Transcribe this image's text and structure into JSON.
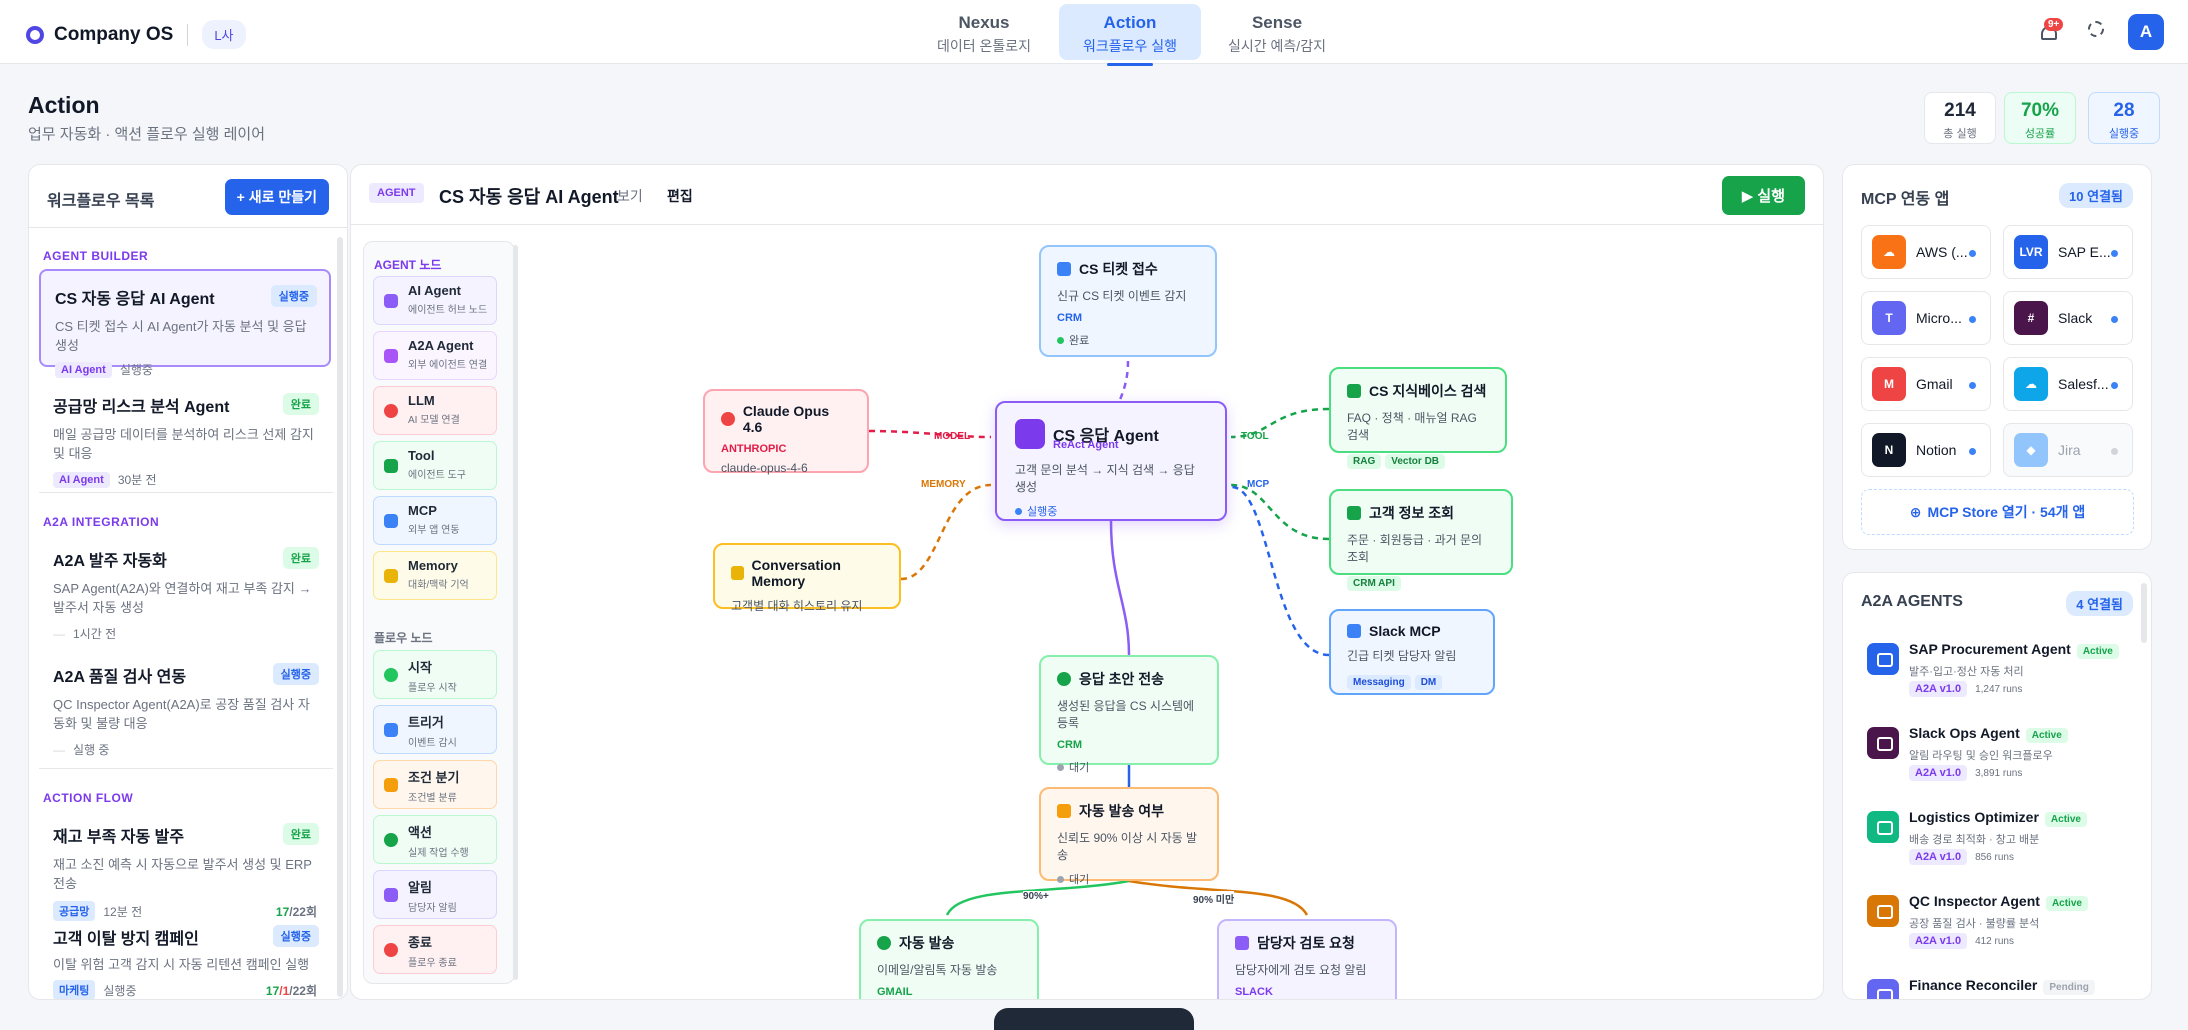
{
  "app": {
    "name": "Company OS",
    "tenant": "L사"
  },
  "nav": [
    {
      "label": "Nexus",
      "sub": "데이터 온톨로지"
    },
    {
      "label": "Action",
      "sub": "워크플로우 실행"
    },
    {
      "label": "Sense",
      "sub": "실시간 예측/감지"
    }
  ],
  "header": {
    "notif_badge": "9+",
    "avatar": "A"
  },
  "page": {
    "title": "Action",
    "subtitle": "업무 자동화 · 액션 플로우 실행 레이어"
  },
  "stats": [
    {
      "value": "214",
      "label": "총 실행"
    },
    {
      "value": "70%",
      "label": "성공률"
    },
    {
      "value": "28",
      "label": "실행중"
    }
  ],
  "workflows": {
    "title": "워크플로우 목록",
    "new_button": "+ 새로 만들기",
    "sections": [
      "AGENT BUILDER",
      "A2A INTEGRATION",
      "ACTION FLOW"
    ],
    "items": [
      {
        "name": "CS 자동 응답 AI Agent",
        "status": "실행중",
        "desc": "CS 티켓 접수 시 AI Agent가 자동 분석 및 응답 생성",
        "tag": "AI Agent",
        "meta": "실행중"
      },
      {
        "name": "공급망 리스크 분석 Agent",
        "status": "완료",
        "desc": "매일 공급망 데이터를 분석하여 리스크 선제 감지 및 대응",
        "tag": "AI Agent",
        "meta": "30분 전"
      },
      {
        "name": "A2A 발주 자동화",
        "status": "완료",
        "desc": "SAP Agent(A2A)와 연결하여 재고 부족 감지 → 발주서 자동 생성",
        "meta": "1시간 전"
      },
      {
        "name": "A2A 품질 검사 연동",
        "status": "실행중",
        "desc": "QC Inspector Agent(A2A)로 공장 품질 검사 자동화 및 불량 대응",
        "meta": "실행 중"
      },
      {
        "name": "재고 부족 자동 발주",
        "status": "완료",
        "desc": "재고 소진 예측 시 자동으로 발주서 생성 및 ERP 전송",
        "tag": "공급망",
        "meta": "12분 전",
        "count_ok": "17",
        "count_total": "/22회"
      },
      {
        "name": "고객 이탈 방지 캠페인",
        "status": "실행중",
        "desc": "이탈 위험 고객 감지 시 자동 리텐션 캠페인 실행",
        "tag": "마케팅",
        "meta": "실행중",
        "count_ok": "17",
        "count_fail": "/1",
        "count_total": "/22회"
      }
    ]
  },
  "canvas": {
    "tag": "AGENT",
    "title": "CS 자동 응답 AI Agent",
    "view_tab": "보기",
    "edit_tab": "편집",
    "run_button": "실행",
    "palette": {
      "agent_header": "AGENT 노드",
      "flow_header": "플로우 노드",
      "agent_nodes": [
        {
          "name": "AI Agent",
          "sub": "에이전트 허브 노드"
        },
        {
          "name": "A2A Agent",
          "sub": "외부 에이전트 연결"
        },
        {
          "name": "LLM",
          "sub": "AI 모델 연결"
        },
        {
          "name": "Tool",
          "sub": "에이전트 도구"
        },
        {
          "name": "MCP",
          "sub": "외부 앱 연동"
        },
        {
          "name": "Memory",
          "sub": "대화/맥락 기억"
        }
      ],
      "flow_nodes": [
        {
          "name": "시작",
          "sub": "플로우 시작"
        },
        {
          "name": "트리거",
          "sub": "이벤트 감시"
        },
        {
          "name": "조건 분기",
          "sub": "조건별 분류"
        },
        {
          "name": "액션",
          "sub": "실제 작업 수행"
        },
        {
          "name": "알림",
          "sub": "담당자 알림"
        },
        {
          "name": "종료",
          "sub": "플로우 종료"
        }
      ]
    },
    "nodes": {
      "ticket": {
        "title": "CS 티켓 접수",
        "desc": "신규 CS 티켓 이벤트 감지",
        "tag": "CRM",
        "status": "완료"
      },
      "agent": {
        "title": "CS 응답 Agent",
        "subtitle": "ReAct Agent",
        "desc": "고객 문의 분석 → 지식 검색 → 응답 생성",
        "status": "실행중"
      },
      "llm": {
        "title": "Claude Opus 4.6",
        "provider": "ANTHROPIC",
        "model": "claude-opus-4-6"
      },
      "memory": {
        "title": "Conversation Memory",
        "desc": "고객별 대화 히스토리 유지"
      },
      "kb": {
        "title": "CS 지식베이스 검색",
        "desc": "FAQ · 정책 · 매뉴얼 RAG 검색",
        "chips": [
          "RAG",
          "Vector DB"
        ]
      },
      "cust": {
        "title": "고객 정보 조회",
        "desc": "주문 · 회원등급 · 과거 문의 조회",
        "chips": [
          "CRM API"
        ]
      },
      "slack": {
        "title": "Slack MCP",
        "desc": "긴급 티켓 담당자 알림",
        "chips": [
          "Messaging",
          "DM"
        ]
      },
      "draft": {
        "title": "응답 초안 전송",
        "desc": "생성된 응답을 CS 시스템에 등록",
        "tag": "CRM",
        "status": "대기"
      },
      "cond": {
        "title": "자동 발송 여부",
        "desc": "신뢰도 90% 이상 시 자동 발송",
        "status": "대기"
      },
      "auto": {
        "title": "자동 발송",
        "desc": "이메일/알림톡 자동 발송",
        "tag": "GMAIL"
      },
      "review": {
        "title": "담당자 검토 요청",
        "desc": "담당자에게 검토 요청 알림",
        "tag": "SLACK"
      }
    },
    "edge_labels": {
      "model": "MODEL",
      "memory": "MEMORY",
      "tool": "TOOL",
      "mcp": "MCP",
      "yes": "90%+",
      "no": "90% 미만"
    }
  },
  "mcp": {
    "title": "MCP 연동 앱",
    "count": "10 연결됨",
    "apps": [
      {
        "name": "AWS (...",
        "icon": "cloud-icon",
        "color": "#f97316"
      },
      {
        "name": "SAP E...",
        "icon": "sap-icon",
        "color": "#2563eb"
      },
      {
        "name": "Micro...",
        "icon": "teams-icon",
        "color": "#6366f1"
      },
      {
        "name": "Slack",
        "icon": "slack-icon",
        "color": "#4a154b"
      },
      {
        "name": "Gmail",
        "icon": "gmail-icon",
        "color": "#ef4444"
      },
      {
        "name": "Salesf...",
        "icon": "salesforce-icon",
        "color": "#0ea5e9"
      },
      {
        "name": "Notion",
        "icon": "notion-icon",
        "color": "#111827"
      },
      {
        "name": "Jira",
        "icon": "jira-icon",
        "color": "#93c5fd"
      }
    ],
    "store": "MCP Store 열기 · 54개 앱"
  },
  "a2a": {
    "title": "A2A AGENTS",
    "count": "4 연결됨",
    "agents": [
      {
        "name": "SAP Procurement Agent",
        "status": "Active",
        "desc": "발주·입고·정산 자동 처리",
        "version": "A2A v1.0",
        "runs": "1,247 runs",
        "color": "#2563eb"
      },
      {
        "name": "Slack Ops Agent",
        "status": "Active",
        "desc": "알림 라우팅 및 승인 워크플로우",
        "version": "A2A v1.0",
        "runs": "3,891 runs",
        "color": "#4a154b"
      },
      {
        "name": "Logistics Optimizer",
        "status": "Active",
        "desc": "배송 경로 최적화 · 창고 배분",
        "version": "A2A v1.0",
        "runs": "856 runs",
        "color": "#10b981"
      },
      {
        "name": "QC Inspector Agent",
        "status": "Active",
        "desc": "공장 품질 검사 · 불량률 분석",
        "version": "A2A v1.0",
        "runs": "412 runs",
        "color": "#d97706"
      },
      {
        "name": "Finance Reconciler",
        "status": "Pending",
        "desc": "",
        "version": "",
        "runs": "",
        "color": "#6366f1"
      }
    ]
  }
}
